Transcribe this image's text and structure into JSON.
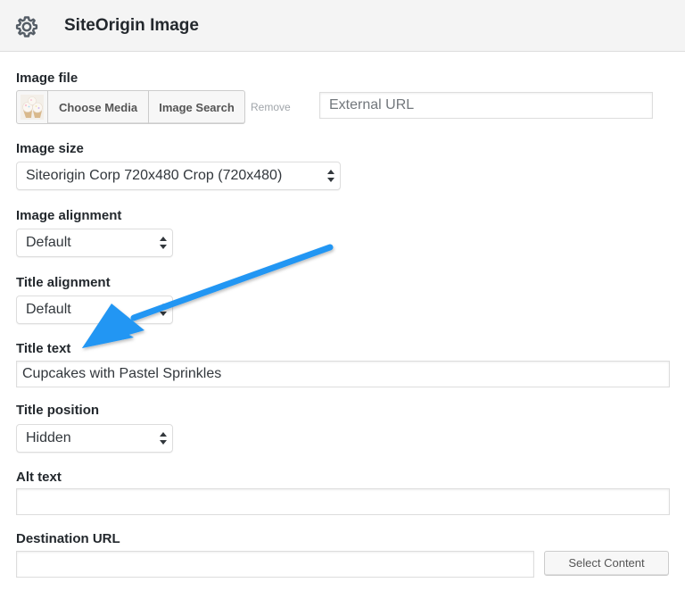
{
  "header": {
    "title": "SiteOrigin Image",
    "icon": "gear-icon"
  },
  "fields": {
    "image_file": {
      "label": "Image file",
      "choose_media_label": "Choose Media",
      "image_search_label": "Image Search",
      "remove_label": "Remove",
      "external_url_placeholder": "External URL",
      "thumbnail": "cupcake-thumbnail"
    },
    "image_size": {
      "label": "Image size",
      "value": "Siteorigin Corp 720x480 Crop (720x480)"
    },
    "image_alignment": {
      "label": "Image alignment",
      "value": "Default"
    },
    "title_alignment": {
      "label": "Title alignment",
      "value": "Default"
    },
    "title_text": {
      "label": "Title text",
      "value": "Cupcakes with Pastel Sprinkles"
    },
    "title_position": {
      "label": "Title position",
      "value": "Hidden"
    },
    "alt_text": {
      "label": "Alt text",
      "value": ""
    },
    "destination_url": {
      "label": "Destination URL",
      "value": "",
      "select_content_label": "Select Content"
    }
  },
  "annotation": {
    "type": "arrow",
    "color": "#1e90ff",
    "points_to": "title-text-label"
  }
}
